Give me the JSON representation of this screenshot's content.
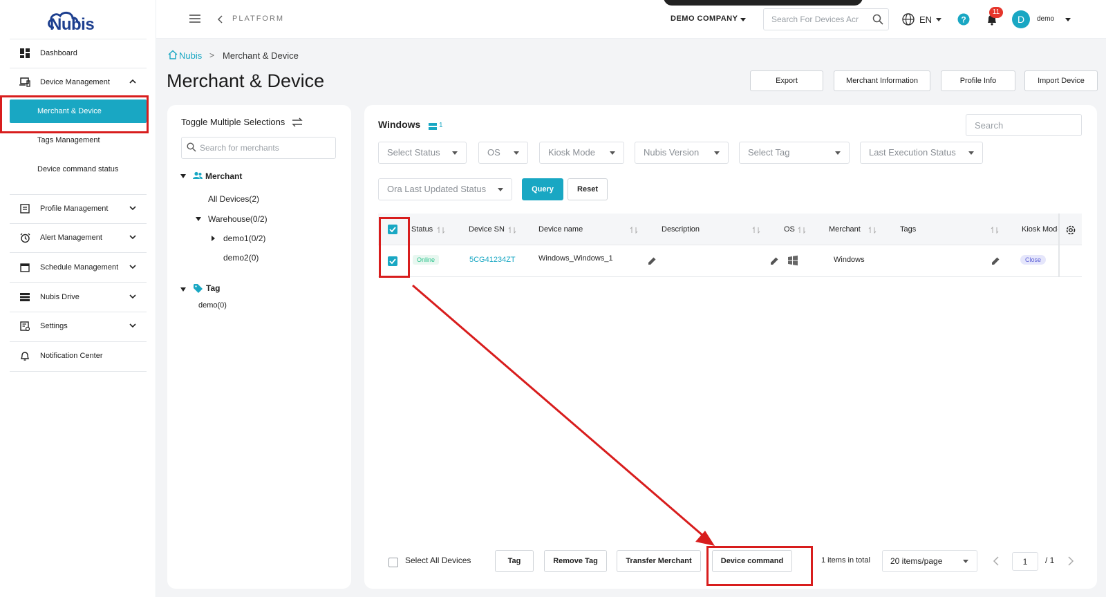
{
  "header": {
    "section_label": "PLATFORM",
    "company": "DEMO COMPANY",
    "search_placeholder": "Search For Devices Acr",
    "language": "EN",
    "notification_count": "11",
    "avatar_initial": "D",
    "user_name": "demo"
  },
  "sidebar": {
    "logo_text": "Nubis",
    "items": [
      {
        "label": "Dashboard",
        "icon": "dashboard-icon"
      },
      {
        "label": "Device Management",
        "icon": "device-icon"
      },
      {
        "label": "Profile Management",
        "icon": "profile-icon"
      },
      {
        "label": "Alert Management",
        "icon": "alarm-icon"
      },
      {
        "label": "Schedule Management",
        "icon": "calendar-icon"
      },
      {
        "label": "Nubis Drive",
        "icon": "drive-icon"
      },
      {
        "label": "Settings",
        "icon": "settings-icon"
      },
      {
        "label": "Notification Center",
        "icon": "bell-icon"
      }
    ],
    "device_sub": [
      {
        "label": "Merchant & Device",
        "active": true
      },
      {
        "label": "Tags Management",
        "active": false
      },
      {
        "label": "Device command status",
        "active": false
      }
    ]
  },
  "breadcrumb": {
    "home": "Nubis",
    "current": "Merchant & Device"
  },
  "page": {
    "title": "Merchant & Device",
    "buttons": [
      "Export",
      "Merchant Information",
      "Profile Info",
      "Import Device"
    ]
  },
  "tree": {
    "toggle_label": "Toggle Multiple Selections",
    "search_placeholder": "Search for merchants",
    "merchant_label": "Merchant",
    "nodes": [
      "All Devices(2)",
      "Warehouse(0/2)",
      "demo1(0/2)",
      "demo2(0)"
    ],
    "tag_label": "Tag",
    "tags": [
      "demo(0)"
    ]
  },
  "devices": {
    "group_title": "Windows",
    "group_count": "1",
    "search_placeholder": "Search",
    "filters": [
      "Select Status",
      "OS",
      "Kiosk Mode",
      "Nubis Version",
      "Select Tag",
      "Last Execution Status",
      "Ora Last Updated Status"
    ],
    "query_label": "Query",
    "reset_label": "Reset",
    "columns": [
      "Status",
      "Device SN",
      "Device name",
      "Description",
      "OS",
      "Merchant",
      "Tags",
      "Kiosk Mode"
    ],
    "rows": [
      {
        "status": "Online",
        "sn": "5CG41234ZT",
        "name": "Windows_Windows_1",
        "description": "",
        "os": "windows-logo-icon",
        "merchant": "Windows",
        "tags": "",
        "kiosk": "Close"
      }
    ]
  },
  "footer": {
    "select_all": "Select All Devices",
    "buttons": [
      "Tag",
      "Remove Tag",
      "Transfer Merchant",
      "Device command"
    ],
    "total": "1 items in total",
    "page_size": "20 items/page",
    "page": "1",
    "page_of": "/ 1"
  },
  "colors": {
    "accent": "#19a7c3",
    "annotation": "#d81d1d",
    "online": "#27c28a",
    "badge": "#e5352b"
  }
}
